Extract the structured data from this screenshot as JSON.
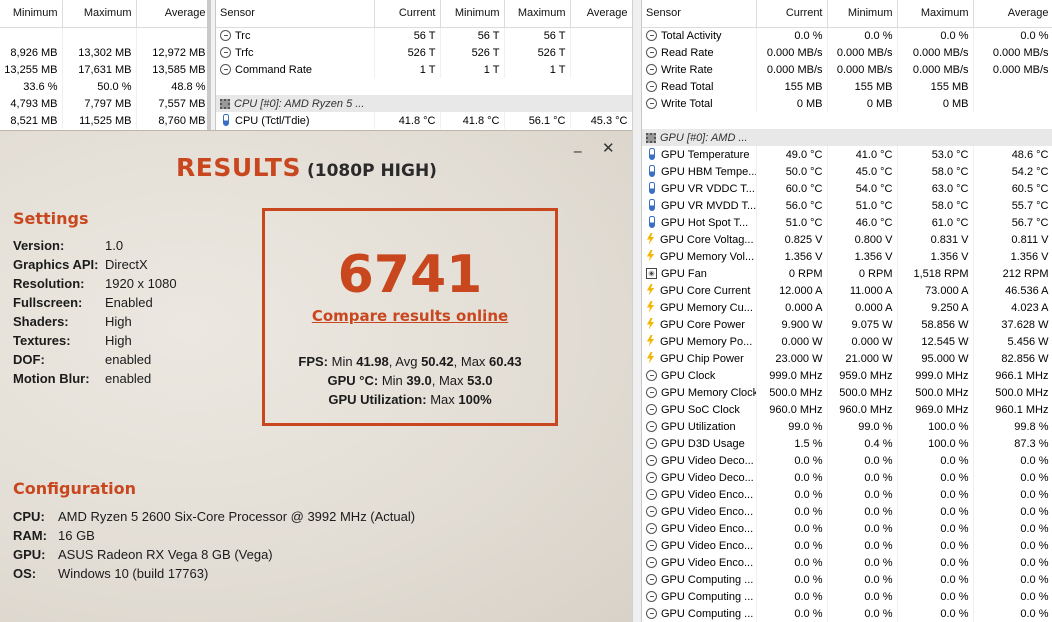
{
  "memory_pane": {
    "headers": [
      "Minimum",
      "Maximum",
      "Average"
    ],
    "rows": [
      [
        "",
        "",
        ""
      ],
      [
        "8,926 MB",
        "13,302 MB",
        "12,972 MB"
      ],
      [
        "13,255 MB",
        "17,631 MB",
        "13,585 MB"
      ],
      [
        "33.6 %",
        "50.0 %",
        "48.8 %"
      ],
      [
        "4,793 MB",
        "7,797 MB",
        "7,557 MB"
      ],
      [
        "8,521 MB",
        "11,525 MB",
        "8,760 MB"
      ]
    ]
  },
  "timing_pane": {
    "headers": [
      "Sensor",
      "Current",
      "Minimum",
      "Maximum",
      "Average"
    ],
    "rows": [
      {
        "icon": "clock",
        "name": "Trc",
        "cur": "56 T",
        "min": "56 T",
        "max": "56 T",
        "avg": ""
      },
      {
        "icon": "clock",
        "name": "Trfc",
        "cur": "526 T",
        "min": "526 T",
        "max": "526 T",
        "avg": ""
      },
      {
        "icon": "clock",
        "name": "Command Rate",
        "cur": "1 T",
        "min": "1 T",
        "max": "1 T",
        "avg": ""
      },
      {
        "blank": true
      },
      {
        "group": true,
        "icon": "chip",
        "name": "CPU [#0]: AMD Ryzen 5 ..."
      },
      {
        "icon": "therm",
        "name": "CPU (Tctl/Tdie)",
        "cur": "41.8 °C",
        "min": "41.8 °C",
        "max": "56.1 °C",
        "avg": "45.3 °C"
      }
    ]
  },
  "gpu_pane": {
    "headers": [
      "Sensor",
      "Current",
      "Minimum",
      "Maximum",
      "Average"
    ],
    "rows": [
      {
        "icon": "clock",
        "name": "Total Activity",
        "cur": "0.0 %",
        "min": "0.0 %",
        "max": "0.0 %",
        "avg": "0.0 %"
      },
      {
        "icon": "clock",
        "name": "Read Rate",
        "cur": "0.000 MB/s",
        "min": "0.000 MB/s",
        "max": "0.000 MB/s",
        "avg": "0.000 MB/s"
      },
      {
        "icon": "clock",
        "name": "Write Rate",
        "cur": "0.000 MB/s",
        "min": "0.000 MB/s",
        "max": "0.000 MB/s",
        "avg": "0.000 MB/s"
      },
      {
        "icon": "clock",
        "name": "Read Total",
        "cur": "155 MB",
        "min": "155 MB",
        "max": "155 MB",
        "avg": ""
      },
      {
        "icon": "clock",
        "name": "Write Total",
        "cur": "0 MB",
        "min": "0 MB",
        "max": "0 MB",
        "avg": ""
      },
      {
        "blank": true
      },
      {
        "group": true,
        "icon": "chip",
        "name": "GPU [#0]: AMD ..."
      },
      {
        "icon": "therm",
        "name": "GPU Temperature",
        "cur": "49.0 °C",
        "min": "41.0 °C",
        "max": "53.0 °C",
        "avg": "48.6 °C"
      },
      {
        "icon": "therm",
        "name": "GPU HBM Tempe...",
        "cur": "50.0 °C",
        "min": "45.0 °C",
        "max": "58.0 °C",
        "avg": "54.2 °C"
      },
      {
        "icon": "therm",
        "name": "GPU VR VDDC T...",
        "cur": "60.0 °C",
        "min": "54.0 °C",
        "max": "63.0 °C",
        "avg": "60.5 °C"
      },
      {
        "icon": "therm",
        "name": "GPU VR MVDD T...",
        "cur": "56.0 °C",
        "min": "51.0 °C",
        "max": "58.0 °C",
        "avg": "55.7 °C"
      },
      {
        "icon": "therm",
        "name": "GPU Hot Spot T...",
        "cur": "51.0 °C",
        "min": "46.0 °C",
        "max": "61.0 °C",
        "avg": "56.7 °C"
      },
      {
        "icon": "bolt",
        "name": "GPU Core Voltag...",
        "cur": "0.825 V",
        "min": "0.800 V",
        "max": "0.831 V",
        "avg": "0.811 V"
      },
      {
        "icon": "bolt",
        "name": "GPU Memory Vol...",
        "cur": "1.356 V",
        "min": "1.356 V",
        "max": "1.356 V",
        "avg": "1.356 V"
      },
      {
        "icon": "fan",
        "name": "GPU Fan",
        "cur": "0 RPM",
        "min": "0 RPM",
        "max": "1,518 RPM",
        "avg": "212 RPM"
      },
      {
        "icon": "bolt",
        "name": "GPU Core Current",
        "cur": "12.000 A",
        "min": "11.000 A",
        "max": "73.000 A",
        "avg": "46.536 A"
      },
      {
        "icon": "bolt",
        "name": "GPU Memory Cu...",
        "cur": "0.000 A",
        "min": "0.000 A",
        "max": "9.250 A",
        "avg": "4.023 A"
      },
      {
        "icon": "bolt",
        "name": "GPU Core Power",
        "cur": "9.900 W",
        "min": "9.075 W",
        "max": "58.856 W",
        "avg": "37.628 W"
      },
      {
        "icon": "bolt",
        "name": "GPU Memory Po...",
        "cur": "0.000 W",
        "min": "0.000 W",
        "max": "12.545 W",
        "avg": "5.456 W"
      },
      {
        "icon": "bolt",
        "name": "GPU Chip Power",
        "cur": "23.000 W",
        "min": "21.000 W",
        "max": "95.000 W",
        "avg": "82.856 W"
      },
      {
        "icon": "clock",
        "name": "GPU Clock",
        "cur": "999.0 MHz",
        "min": "959.0 MHz",
        "max": "999.0 MHz",
        "avg": "966.1 MHz"
      },
      {
        "icon": "clock",
        "name": "GPU Memory Clock",
        "cur": "500.0 MHz",
        "min": "500.0 MHz",
        "max": "500.0 MHz",
        "avg": "500.0 MHz"
      },
      {
        "icon": "clock",
        "name": "GPU SoC Clock",
        "cur": "960.0 MHz",
        "min": "960.0 MHz",
        "max": "969.0 MHz",
        "avg": "960.1 MHz"
      },
      {
        "icon": "clock",
        "name": "GPU Utilization",
        "cur": "99.0 %",
        "min": "99.0 %",
        "max": "100.0 %",
        "avg": "99.8 %"
      },
      {
        "icon": "clock",
        "name": "GPU D3D Usage",
        "cur": "1.5 %",
        "min": "0.4 %",
        "max": "100.0 %",
        "avg": "87.3 %"
      },
      {
        "icon": "clock",
        "name": "GPU Video Deco...",
        "cur": "0.0 %",
        "min": "0.0 %",
        "max": "0.0 %",
        "avg": "0.0 %"
      },
      {
        "icon": "clock",
        "name": "GPU Video Deco...",
        "cur": "0.0 %",
        "min": "0.0 %",
        "max": "0.0 %",
        "avg": "0.0 %"
      },
      {
        "icon": "clock",
        "name": "GPU Video Enco...",
        "cur": "0.0 %",
        "min": "0.0 %",
        "max": "0.0 %",
        "avg": "0.0 %"
      },
      {
        "icon": "clock",
        "name": "GPU Video Enco...",
        "cur": "0.0 %",
        "min": "0.0 %",
        "max": "0.0 %",
        "avg": "0.0 %"
      },
      {
        "icon": "clock",
        "name": "GPU Video Enco...",
        "cur": "0.0 %",
        "min": "0.0 %",
        "max": "0.0 %",
        "avg": "0.0 %"
      },
      {
        "icon": "clock",
        "name": "GPU Video Enco...",
        "cur": "0.0 %",
        "min": "0.0 %",
        "max": "0.0 %",
        "avg": "0.0 %"
      },
      {
        "icon": "clock",
        "name": "GPU Video Enco...",
        "cur": "0.0 %",
        "min": "0.0 %",
        "max": "0.0 %",
        "avg": "0.0 %"
      },
      {
        "icon": "clock",
        "name": "GPU Computing ...",
        "cur": "0.0 %",
        "min": "0.0 %",
        "max": "0.0 %",
        "avg": "0.0 %"
      },
      {
        "icon": "clock",
        "name": "GPU Computing ...",
        "cur": "0.0 %",
        "min": "0.0 %",
        "max": "0.0 %",
        "avg": "0.0 %"
      },
      {
        "icon": "clock",
        "name": "GPU Computing ...",
        "cur": "0.0 %",
        "min": "0.0 %",
        "max": "0.0 %",
        "avg": "0.0 %"
      }
    ]
  },
  "results": {
    "title": "RESULTS",
    "subtitle": "(1080P HIGH)",
    "minimize_glyph": "_",
    "close_glyph": "✕",
    "settings_heading": "Settings",
    "settings": [
      {
        "k": "Version:",
        "v": "1.0"
      },
      {
        "k": "Graphics API:",
        "v": "DirectX"
      },
      {
        "k": "Resolution:",
        "v": "1920 x 1080"
      },
      {
        "k": "Fullscreen:",
        "v": "Enabled"
      },
      {
        "k": "Shaders:",
        "v": "High"
      },
      {
        "k": "Textures:",
        "v": "High"
      },
      {
        "k": "DOF:",
        "v": "enabled"
      },
      {
        "k": "Motion Blur:",
        "v": "enabled"
      }
    ],
    "score": "6741",
    "compare_link": "Compare results online",
    "fps": {
      "label": "FPS:",
      "min_label": "Min",
      "min": "41.98",
      "avg_label": "Avg",
      "avg": "50.42",
      "max_label": "Max",
      "max": "60.43"
    },
    "gpu_temp": {
      "label": "GPU °C:",
      "min_label": "Min",
      "min": "39.0",
      "max_label": "Max",
      "max": "53.0"
    },
    "gpu_util": {
      "label": "GPU Utilization:",
      "max_label": "Max",
      "max": "100%"
    },
    "config_heading": "Configuration",
    "config": [
      {
        "k": "CPU:",
        "v": "AMD Ryzen 5 2600 Six-Core Processor @ 3992 MHz (Actual)"
      },
      {
        "k": "RAM:",
        "v": "16 GB"
      },
      {
        "k": "GPU:",
        "v": "ASUS Radeon RX Vega 8 GB (Vega)"
      },
      {
        "k": "OS:",
        "v": "Windows 10 (build 17763)"
      }
    ],
    "colors": {
      "accent": "#c9471f"
    }
  }
}
